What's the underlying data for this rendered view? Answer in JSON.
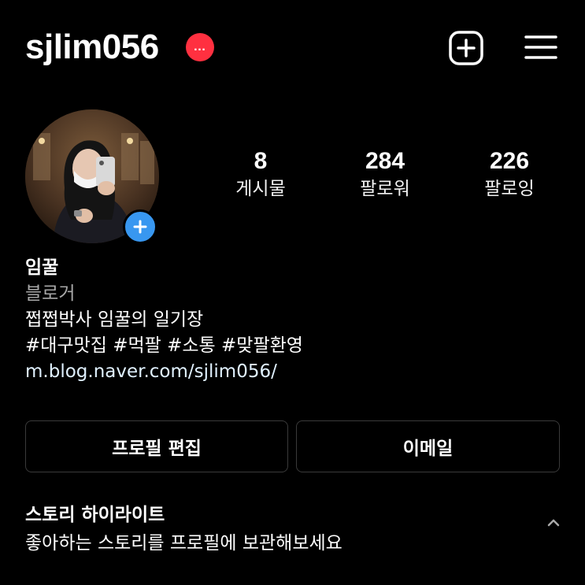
{
  "header": {
    "username": "sjlim056",
    "notification_badge": "…",
    "badge_color": "#ff3040",
    "new_post_icon": "plus-square-icon",
    "menu_icon": "hamburger-menu-icon"
  },
  "profile": {
    "avatar_icon": "profile-photo",
    "add_story_icon": "plus-icon",
    "add_story_color": "#3897f0",
    "stats": {
      "posts": {
        "count": "8",
        "label": "게시물"
      },
      "followers": {
        "count": "284",
        "label": "팔로워"
      },
      "following": {
        "count": "226",
        "label": "팔로잉"
      }
    },
    "bio": {
      "name": "임꿀",
      "category": "블로거",
      "line1": "쩝쩝박사 임꿀의 일기장",
      "hashtags": "#대구맛집 #먹팔 #소통 #맞팔환영",
      "link": "m.blog.naver.com/sjlim056/"
    }
  },
  "actions": {
    "edit_profile": "프로필 편집",
    "email": "이메일"
  },
  "highlights": {
    "title": "스토리 하이라이트",
    "description": "좋아하는 스토리를 프로필에 보관해보세요",
    "toggle_icon": "chevron-up-icon"
  }
}
